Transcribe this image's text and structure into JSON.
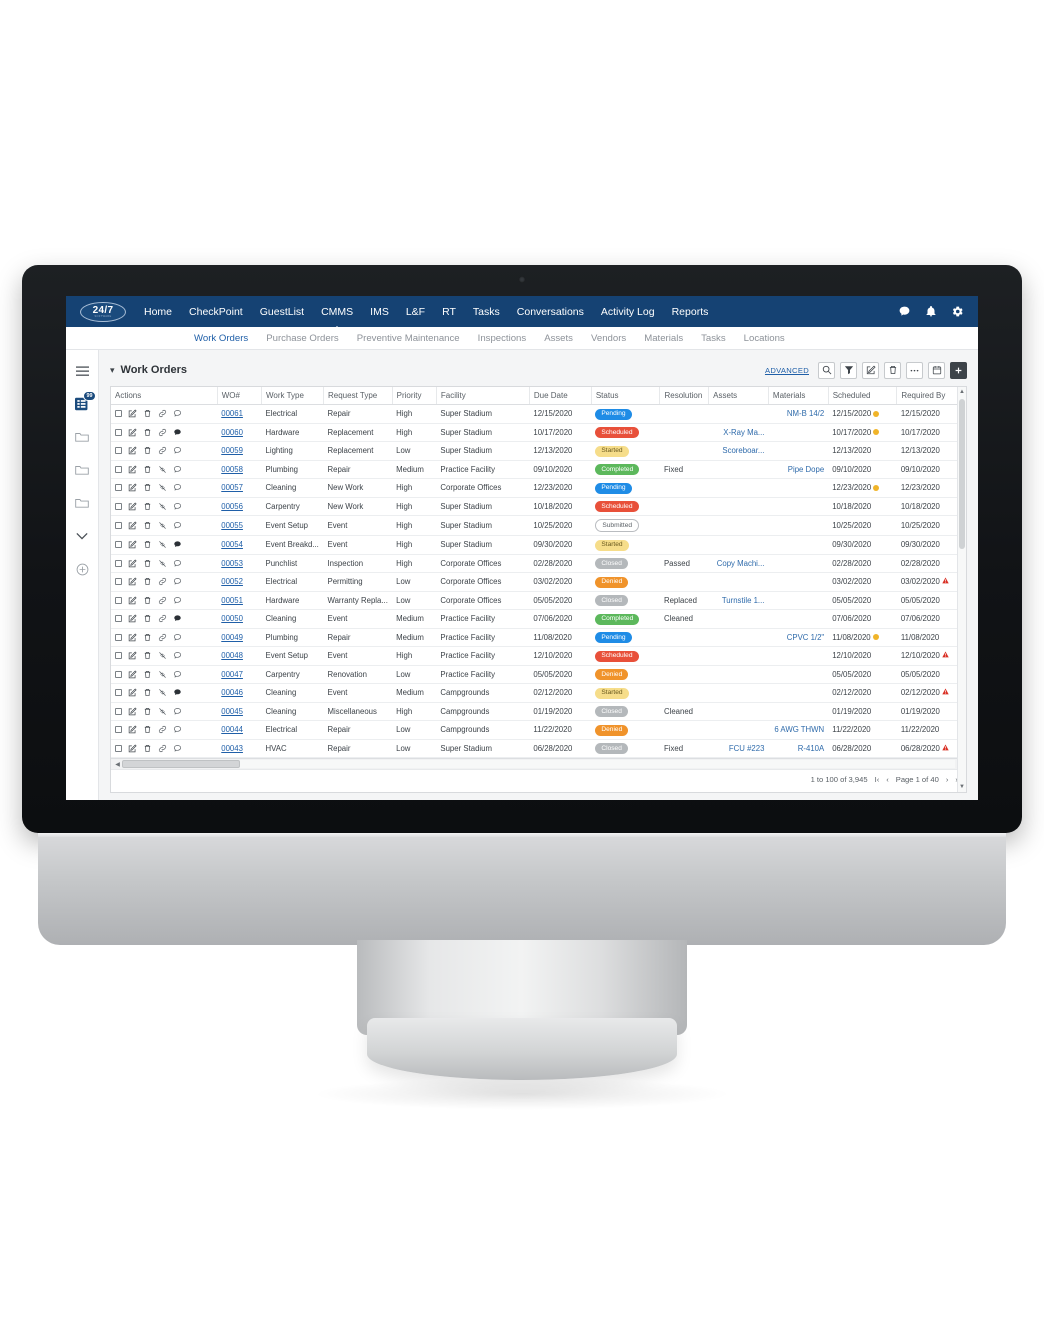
{
  "brand": {
    "logo_text": "24/7",
    "logo_subtext": "SOFTWARE",
    "accent_navy": "#154273",
    "link_blue": "#1f5fa8"
  },
  "topnav": {
    "items": [
      {
        "label": "Home",
        "active": false
      },
      {
        "label": "CheckPoint",
        "active": false
      },
      {
        "label": "GuestList",
        "active": false
      },
      {
        "label": "CMMS",
        "active": true
      },
      {
        "label": "IMS",
        "active": false
      },
      {
        "label": "L&F",
        "active": false
      },
      {
        "label": "RT",
        "active": false
      },
      {
        "label": "Tasks",
        "active": false
      },
      {
        "label": "Conversations",
        "active": false
      },
      {
        "label": "Activity Log",
        "active": false
      },
      {
        "label": "Reports",
        "active": false
      }
    ],
    "right_icons": [
      "chat-icon",
      "bell-icon",
      "gear-icon"
    ]
  },
  "subnav": {
    "items": [
      {
        "label": "Work Orders",
        "active": true
      },
      {
        "label": "Purchase Orders",
        "active": false
      },
      {
        "label": "Preventive Maintenance",
        "active": false
      },
      {
        "label": "Inspections",
        "active": false
      },
      {
        "label": "Assets",
        "active": false
      },
      {
        "label": "Vendors",
        "active": false
      },
      {
        "label": "Materials",
        "active": false
      },
      {
        "label": "Tasks",
        "active": false
      },
      {
        "label": "Locations",
        "active": false
      }
    ]
  },
  "rail": {
    "menu_icon": "hamburger-icon",
    "list_badge": "99",
    "items": [
      "list-view-icon",
      "folder-icon",
      "folder-icon",
      "folder-icon",
      "chevron-down-icon",
      "plus-circle-icon"
    ]
  },
  "panel": {
    "title": "Work Orders",
    "advanced_label": "ADVANCED",
    "tools": [
      "search-icon",
      "filter-icon",
      "edit-icon",
      "delete-icon",
      "more-icon",
      "calendar-icon",
      "add-icon"
    ]
  },
  "table": {
    "columns": [
      "Actions",
      "WO#",
      "Work Type",
      "Request Type",
      "Priority",
      "Facility",
      "Due Date",
      "Status",
      "Resolution",
      "Assets",
      "Materials",
      "Scheduled",
      "Required By"
    ],
    "rows": [
      {
        "wo": "00061",
        "work_type": "Electrical",
        "request_type": "Repair",
        "priority": "High",
        "facility": "Super Stadium",
        "due": "12/15/2020",
        "status": "Pending",
        "status_color": "#1f8ce6",
        "resolution": "",
        "assets": "",
        "materials": "NM-B 14/2",
        "scheduled": "12/15/2020",
        "sched_warn": true,
        "required": "12/15/2020",
        "req_alert": false,
        "link_broken": false,
        "comment_filled": false
      },
      {
        "wo": "00060",
        "work_type": "Hardware",
        "request_type": "Replacement",
        "priority": "High",
        "facility": "Super Stadium",
        "due": "10/17/2020",
        "status": "Scheduled",
        "status_color": "#e8503a",
        "resolution": "",
        "assets": "X-Ray Ma...",
        "materials": "",
        "scheduled": "10/17/2020",
        "sched_warn": true,
        "required": "10/17/2020",
        "req_alert": false,
        "link_broken": false,
        "comment_filled": true
      },
      {
        "wo": "00059",
        "work_type": "Lighting",
        "request_type": "Replacement",
        "priority": "Low",
        "facility": "Super Stadium",
        "due": "12/13/2020",
        "status": "Started",
        "status_color": "#f6dd8a",
        "resolution": "",
        "assets": "Scoreboar...",
        "materials": "",
        "scheduled": "12/13/2020",
        "sched_warn": false,
        "required": "12/13/2020",
        "req_alert": false,
        "link_broken": false,
        "comment_filled": false
      },
      {
        "wo": "00058",
        "work_type": "Plumbing",
        "request_type": "Repair",
        "priority": "Medium",
        "facility": "Practice Facility",
        "due": "09/10/2020",
        "status": "Completed",
        "status_color": "#5cb85c",
        "resolution": "Fixed",
        "assets": "",
        "materials": "Pipe Dope",
        "scheduled": "09/10/2020",
        "sched_warn": false,
        "required": "09/10/2020",
        "req_alert": false,
        "link_broken": true,
        "comment_filled": false
      },
      {
        "wo": "00057",
        "work_type": "Cleaning",
        "request_type": "New Work",
        "priority": "High",
        "facility": "Corporate Offices",
        "due": "12/23/2020",
        "status": "Pending",
        "status_color": "#1f8ce6",
        "resolution": "",
        "assets": "",
        "materials": "",
        "scheduled": "12/23/2020",
        "sched_warn": true,
        "required": "12/23/2020",
        "req_alert": false,
        "link_broken": true,
        "comment_filled": false
      },
      {
        "wo": "00056",
        "work_type": "Carpentry",
        "request_type": "New Work",
        "priority": "High",
        "facility": "Super Stadium",
        "due": "10/18/2020",
        "status": "Scheduled",
        "status_color": "#e8503a",
        "resolution": "",
        "assets": "",
        "materials": "",
        "scheduled": "10/18/2020",
        "sched_warn": false,
        "required": "10/18/2020",
        "req_alert": false,
        "link_broken": true,
        "comment_filled": false
      },
      {
        "wo": "00055",
        "work_type": "Event Setup",
        "request_type": "Event",
        "priority": "High",
        "facility": "Super Stadium",
        "due": "10/25/2020",
        "status": "Submitted",
        "status_color": "outline",
        "resolution": "",
        "assets": "",
        "materials": "",
        "scheduled": "10/25/2020",
        "sched_warn": false,
        "required": "10/25/2020",
        "req_alert": false,
        "link_broken": true,
        "comment_filled": false
      },
      {
        "wo": "00054",
        "work_type": "Event Breakd...",
        "request_type": "Event",
        "priority": "High",
        "facility": "Super Stadium",
        "due": "09/30/2020",
        "status": "Started",
        "status_color": "#f6dd8a",
        "resolution": "",
        "assets": "",
        "materials": "",
        "scheduled": "09/30/2020",
        "sched_warn": false,
        "required": "09/30/2020",
        "req_alert": false,
        "link_broken": true,
        "comment_filled": true
      },
      {
        "wo": "00053",
        "work_type": "Punchlist",
        "request_type": "Inspection",
        "priority": "High",
        "facility": "Corporate Offices",
        "due": "02/28/2020",
        "status": "Closed",
        "status_color": "#b4b8bb",
        "resolution": "Passed",
        "assets": "Copy Machi...",
        "materials": "",
        "scheduled": "02/28/2020",
        "sched_warn": false,
        "required": "02/28/2020",
        "req_alert": false,
        "link_broken": true,
        "comment_filled": false
      },
      {
        "wo": "00052",
        "work_type": "Electrical",
        "request_type": "Permitting",
        "priority": "Low",
        "facility": "Corporate Offices",
        "due": "03/02/2020",
        "status": "Denied",
        "status_color": "#f0932b",
        "resolution": "",
        "assets": "",
        "materials": "",
        "scheduled": "03/02/2020",
        "sched_warn": false,
        "required": "03/02/2020",
        "req_alert": true,
        "link_broken": false,
        "comment_filled": false
      },
      {
        "wo": "00051",
        "work_type": "Hardware",
        "request_type": "Warranty Repla...",
        "priority": "Low",
        "facility": "Corporate Offices",
        "due": "05/05/2020",
        "status": "Closed",
        "status_color": "#b4b8bb",
        "resolution": "Replaced",
        "assets": "Turnstile 1...",
        "materials": "",
        "scheduled": "05/05/2020",
        "sched_warn": false,
        "required": "05/05/2020",
        "req_alert": false,
        "link_broken": false,
        "comment_filled": false
      },
      {
        "wo": "00050",
        "work_type": "Cleaning",
        "request_type": "Event",
        "priority": "Medium",
        "facility": "Practice Facility",
        "due": "07/06/2020",
        "status": "Completed",
        "status_color": "#5cb85c",
        "resolution": "Cleaned",
        "assets": "",
        "materials": "",
        "scheduled": "07/06/2020",
        "sched_warn": false,
        "required": "07/06/2020",
        "req_alert": false,
        "link_broken": false,
        "comment_filled": true
      },
      {
        "wo": "00049",
        "work_type": "Plumbing",
        "request_type": "Repair",
        "priority": "Medium",
        "facility": "Practice Facility",
        "due": "11/08/2020",
        "status": "Pending",
        "status_color": "#1f8ce6",
        "resolution": "",
        "assets": "",
        "materials": "CPVC 1/2\"",
        "scheduled": "11/08/2020",
        "sched_warn": true,
        "required": "11/08/2020",
        "req_alert": false,
        "link_broken": false,
        "comment_filled": false
      },
      {
        "wo": "00048",
        "work_type": "Event Setup",
        "request_type": "Event",
        "priority": "High",
        "facility": "Practice Facility",
        "due": "12/10/2020",
        "status": "Scheduled",
        "status_color": "#e8503a",
        "resolution": "",
        "assets": "",
        "materials": "",
        "scheduled": "12/10/2020",
        "sched_warn": false,
        "required": "12/10/2020",
        "req_alert": true,
        "link_broken": true,
        "comment_filled": false
      },
      {
        "wo": "00047",
        "work_type": "Carpentry",
        "request_type": "Renovation",
        "priority": "Low",
        "facility": "Practice Facility",
        "due": "05/05/2020",
        "status": "Denied",
        "status_color": "#f0932b",
        "resolution": "",
        "assets": "",
        "materials": "",
        "scheduled": "05/05/2020",
        "sched_warn": false,
        "required": "05/05/2020",
        "req_alert": false,
        "link_broken": true,
        "comment_filled": false
      },
      {
        "wo": "00046",
        "work_type": "Cleaning",
        "request_type": "Event",
        "priority": "Medium",
        "facility": "Campgrounds",
        "due": "02/12/2020",
        "status": "Started",
        "status_color": "#f6dd8a",
        "resolution": "",
        "assets": "",
        "materials": "",
        "scheduled": "02/12/2020",
        "sched_warn": false,
        "required": "02/12/2020",
        "req_alert": true,
        "link_broken": true,
        "comment_filled": true
      },
      {
        "wo": "00045",
        "work_type": "Cleaning",
        "request_type": "Miscellaneous",
        "priority": "High",
        "facility": "Campgrounds",
        "due": "01/19/2020",
        "status": "Closed",
        "status_color": "#b4b8bb",
        "resolution": "Cleaned",
        "assets": "",
        "materials": "",
        "scheduled": "01/19/2020",
        "sched_warn": false,
        "required": "01/19/2020",
        "req_alert": false,
        "link_broken": true,
        "comment_filled": false
      },
      {
        "wo": "00044",
        "work_type": "Electrical",
        "request_type": "Repair",
        "priority": "Low",
        "facility": "Campgrounds",
        "due": "11/22/2020",
        "status": "Denied",
        "status_color": "#f0932b",
        "resolution": "",
        "assets": "",
        "materials": "6 AWG THWN",
        "scheduled": "11/22/2020",
        "sched_warn": false,
        "required": "11/22/2020",
        "req_alert": false,
        "link_broken": false,
        "comment_filled": false
      },
      {
        "wo": "00043",
        "work_type": "HVAC",
        "request_type": "Repair",
        "priority": "Low",
        "facility": "Super Stadium",
        "due": "06/28/2020",
        "status": "Closed",
        "status_color": "#b4b8bb",
        "resolution": "Fixed",
        "assets": "FCU #223",
        "materials": "R-410A",
        "scheduled": "06/28/2020",
        "sched_warn": false,
        "required": "06/28/2020",
        "req_alert": true,
        "link_broken": false,
        "comment_filled": false
      }
    ]
  },
  "footer": {
    "range_text": "1 to 100 of 3,945",
    "first_label": "I‹",
    "prev_label": "‹",
    "page_text": "Page 1 of 40",
    "next_label": "›",
    "last_label": "›I"
  }
}
